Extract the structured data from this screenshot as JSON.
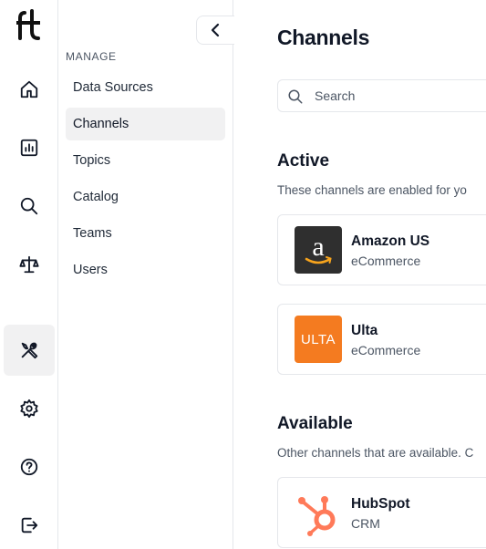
{
  "rail": {
    "logo_text": "ft",
    "items": [
      {
        "icon": "home-icon"
      },
      {
        "icon": "chart-icon"
      },
      {
        "icon": "search-icon"
      },
      {
        "icon": "scale-icon"
      },
      {
        "icon": "tools-icon",
        "active": true
      },
      {
        "icon": "gear-icon"
      },
      {
        "icon": "help-icon"
      },
      {
        "icon": "logout-icon"
      }
    ]
  },
  "subnav": {
    "section_label": "MANAGE",
    "items": [
      {
        "label": "Data Sources"
      },
      {
        "label": "Channels",
        "active": true
      },
      {
        "label": "Topics"
      },
      {
        "label": "Catalog"
      },
      {
        "label": "Teams"
      },
      {
        "label": "Users"
      }
    ]
  },
  "main": {
    "title": "Channels",
    "search_placeholder": "Search",
    "active": {
      "heading": "Active",
      "description": "These channels are enabled for yo",
      "cards": [
        {
          "name": "Amazon US",
          "category": "eCommerce",
          "logo": "amazon-logo",
          "logo_color": "#2f2f2f"
        },
        {
          "name": "Ulta",
          "category": "eCommerce",
          "logo": "ulta-logo",
          "logo_text": "ULTA",
          "logo_color": "#f47b20"
        }
      ]
    },
    "available": {
      "heading": "Available",
      "description": "Other channels that are available. C",
      "cards": [
        {
          "name": "HubSpot",
          "category": "CRM",
          "logo": "hubspot-logo",
          "logo_color": "#ff7a59"
        }
      ]
    }
  }
}
